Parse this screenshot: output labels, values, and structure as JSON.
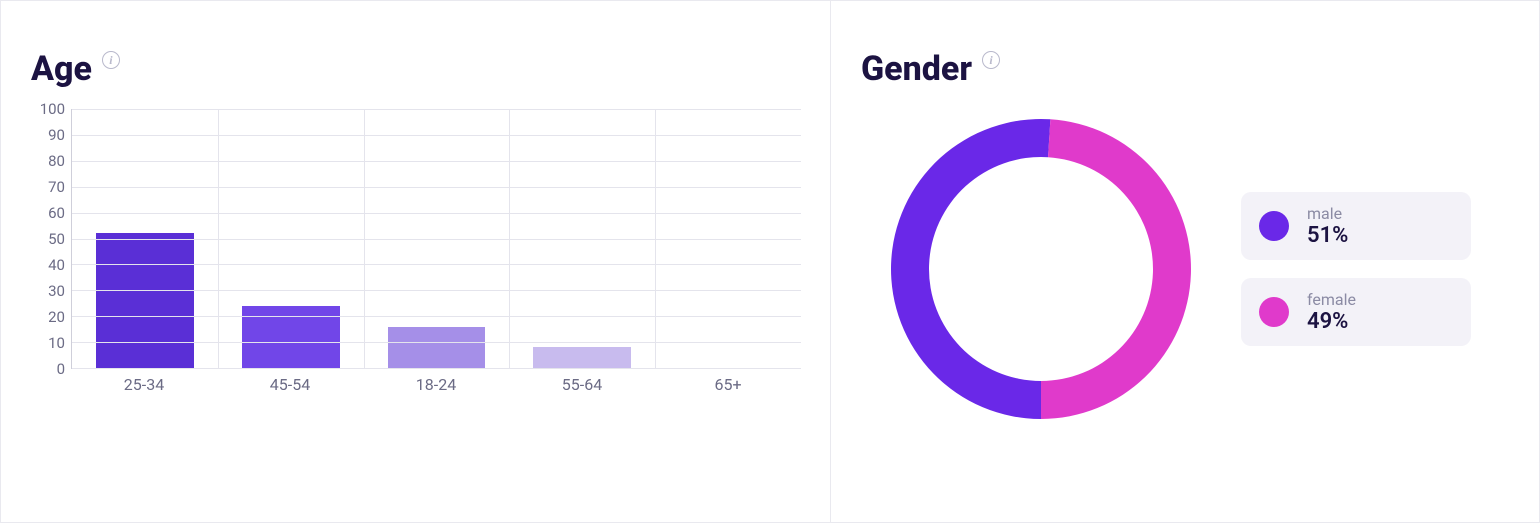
{
  "age_panel": {
    "title": "Age"
  },
  "gender_panel": {
    "title": "Gender"
  },
  "chart_data": [
    {
      "id": "age",
      "type": "bar",
      "title": "Age",
      "categories": [
        "25-34",
        "45-54",
        "18-24",
        "55-64",
        "65+"
      ],
      "values": [
        52,
        24,
        16,
        8,
        0
      ],
      "ylim": [
        0,
        100
      ],
      "yticks": [
        0,
        10,
        20,
        30,
        40,
        50,
        60,
        70,
        80,
        90,
        100
      ],
      "colors": [
        "#5a2fd6",
        "#7146e8",
        "#a58fe8",
        "#c8bbee",
        "#e5e0f5"
      ]
    },
    {
      "id": "gender",
      "type": "pie",
      "title": "Gender",
      "series": [
        {
          "name": "male",
          "value": 51,
          "label": "51%",
          "color": "#6a28e8"
        },
        {
          "name": "female",
          "value": 49,
          "label": "49%",
          "color": "#e03acb"
        }
      ]
    }
  ]
}
